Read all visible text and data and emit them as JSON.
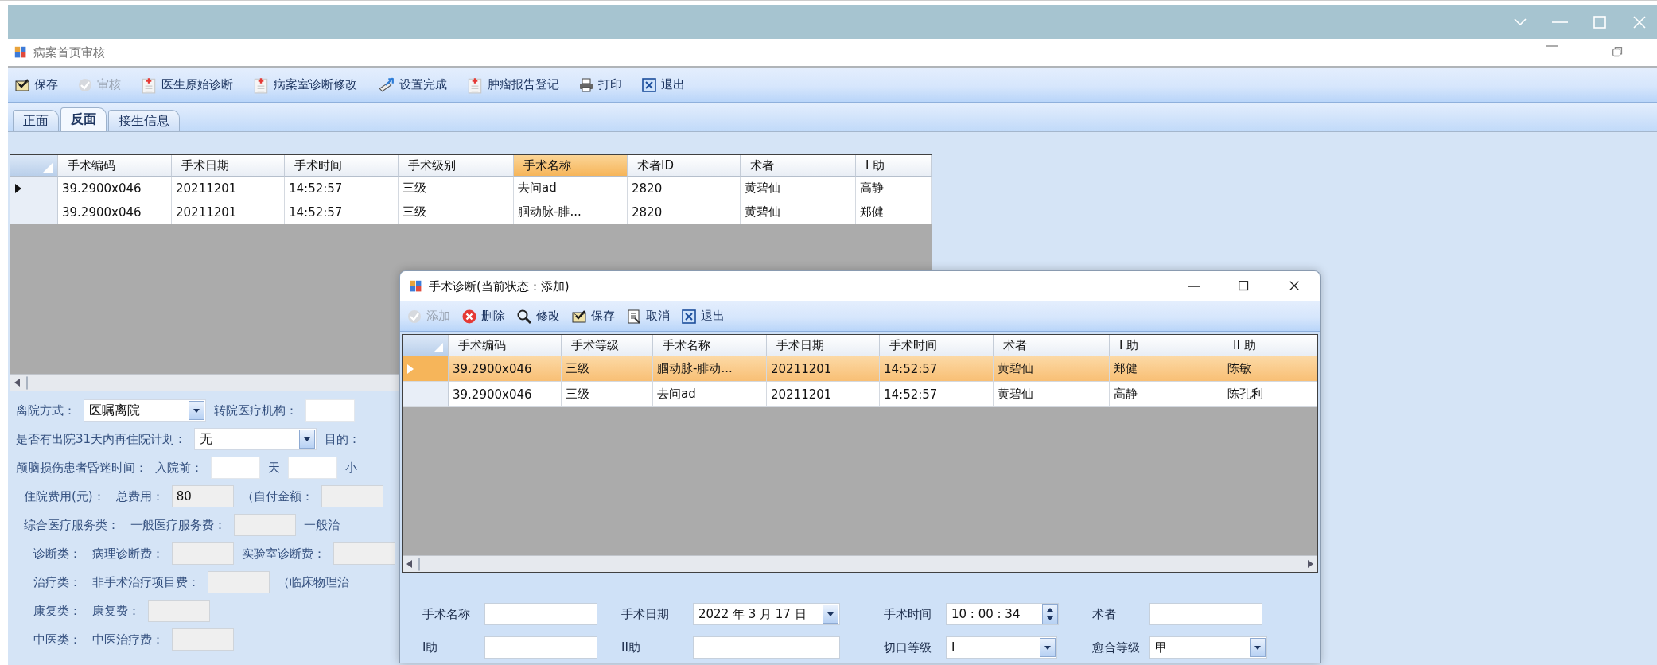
{
  "window": {
    "title": "病案首页审核"
  },
  "toolbar": [
    {
      "label": "保存",
      "kind": "save",
      "disabled": false
    },
    {
      "label": "审核",
      "kind": "check",
      "disabled": true
    },
    {
      "label": "医生原始诊断",
      "kind": "medical-doc",
      "disabled": false
    },
    {
      "label": "病案室诊断修改",
      "kind": "medical-doc",
      "disabled": false
    },
    {
      "label": "设置完成",
      "kind": "wand",
      "disabled": false
    },
    {
      "label": "肿瘤报告登记",
      "kind": "medical-doc",
      "disabled": false
    },
    {
      "label": "打印",
      "kind": "print",
      "disabled": false
    },
    {
      "label": "退出",
      "kind": "exit",
      "disabled": false
    }
  ],
  "tabs": [
    {
      "label": "正面",
      "selected": false
    },
    {
      "label": "反面",
      "selected": true
    },
    {
      "label": "接生信息",
      "selected": false
    }
  ],
  "surgery_table": {
    "columns": [
      {
        "label": "手术编码",
        "highlighted": false
      },
      {
        "label": "手术日期",
        "highlighted": false
      },
      {
        "label": "手术时间",
        "highlighted": false
      },
      {
        "label": "手术级别",
        "highlighted": false
      },
      {
        "label": "手术名称",
        "highlighted": true
      },
      {
        "label": "术者ID",
        "highlighted": false
      },
      {
        "label": "术者",
        "highlighted": false
      },
      {
        "label": "I 助",
        "highlighted": false
      }
    ],
    "rows": [
      {
        "selected": true,
        "cells": [
          "39.2900x046",
          "20211201",
          "14:52:57",
          "三级",
          "去问ad",
          "2820",
          "黄碧仙",
          "高静"
        ]
      },
      {
        "selected": false,
        "cells": [
          "39.2900x046",
          "20211201",
          "14:52:57",
          "三级",
          "腘动脉-腓...",
          "2820",
          "黄碧仙",
          "郑健"
        ]
      }
    ]
  },
  "form": {
    "rows": [
      {
        "kind": "field",
        "items": [
          {
            "kind": "label",
            "text": "离院方式："
          },
          {
            "kind": "combo",
            "value": "医嘱离院"
          },
          {
            "kind": "label",
            "text": "转院医疗机构："
          },
          {
            "kind": "input",
            "disabled": false
          }
        ]
      },
      {
        "kind": "field",
        "items": [
          {
            "kind": "label",
            "text": "是否有出院31天内再住院计划："
          },
          {
            "kind": "combo",
            "value": "无"
          },
          {
            "kind": "label",
            "text": "目的："
          }
        ]
      },
      {
        "kind": "field",
        "items": [
          {
            "kind": "label",
            "text": "颅脑损伤患者昏迷时间："
          },
          {
            "kind": "label",
            "text": "入院前："
          },
          {
            "kind": "input",
            "disabled": false
          },
          {
            "kind": "label",
            "text": "天"
          },
          {
            "kind": "input",
            "disabled": false
          },
          {
            "kind": "label",
            "text": "小"
          }
        ]
      },
      {
        "kind": "fee",
        "items": [
          {
            "kind": "label",
            "text": "住院费用(元)："
          },
          {
            "kind": "label",
            "text": "总费用："
          },
          {
            "kind": "input",
            "value": "80",
            "disabled": true
          },
          {
            "kind": "label",
            "text": "（自付金额："
          },
          {
            "kind": "input",
            "disabled": true
          }
        ]
      },
      {
        "kind": "fee",
        "items": [
          {
            "kind": "label",
            "text": "综合医疗服务类："
          },
          {
            "kind": "label",
            "text": "一般医疗服务费："
          },
          {
            "kind": "input",
            "disabled": true
          },
          {
            "kind": "label",
            "text": "一般治"
          }
        ]
      },
      {
        "kind": "fee",
        "items": [
          {
            "kind": "label",
            "text": "诊断类："
          },
          {
            "kind": "label",
            "text": "病理诊断费："
          },
          {
            "kind": "input",
            "disabled": true
          },
          {
            "kind": "label",
            "text": "实验室诊断费："
          },
          {
            "kind": "input",
            "disabled": true
          }
        ]
      },
      {
        "kind": "fee",
        "items": [
          {
            "kind": "label",
            "text": "治疗类："
          },
          {
            "kind": "label",
            "text": "非手术治疗项目费："
          },
          {
            "kind": "input",
            "disabled": true
          },
          {
            "kind": "label",
            "text": "（临床物理治"
          }
        ]
      },
      {
        "kind": "fee",
        "items": [
          {
            "kind": "label",
            "text": "康复类："
          },
          {
            "kind": "label",
            "text": "康复费："
          },
          {
            "kind": "input",
            "disabled": true
          }
        ]
      },
      {
        "kind": "fee",
        "items": [
          {
            "kind": "label",
            "text": "中医类："
          },
          {
            "kind": "label",
            "text": "中医治疗费："
          },
          {
            "kind": "input",
            "disabled": true
          }
        ]
      }
    ]
  },
  "dialog": {
    "title": "手术诊断(当前状态：添加)",
    "toolbar": [
      {
        "label": "添加",
        "kind": "check",
        "disabled": true
      },
      {
        "label": "删除",
        "kind": "delete",
        "disabled": false
      },
      {
        "label": "修改",
        "kind": "search",
        "disabled": false
      },
      {
        "label": "保存",
        "kind": "save",
        "disabled": false
      },
      {
        "label": "取消",
        "kind": "cancel",
        "disabled": false
      },
      {
        "label": "退出",
        "kind": "exit",
        "disabled": false
      }
    ],
    "table": {
      "columns": [
        {
          "label": "手术编码"
        },
        {
          "label": "手术等级"
        },
        {
          "label": "手术名称"
        },
        {
          "label": "手术日期"
        },
        {
          "label": "手术时间"
        },
        {
          "label": "术者"
        },
        {
          "label": "I 助"
        },
        {
          "label": "II 助"
        }
      ],
      "rows": [
        {
          "selected": true,
          "cells": [
            "39.2900x046",
            "三级",
            "腘动脉-腓动...",
            "20211201",
            "14:52:57",
            "黄碧仙",
            "郑健",
            "陈敏"
          ]
        },
        {
          "selected": false,
          "cells": [
            "39.2900x046",
            "三级",
            "去问ad",
            "20211201",
            "14:52:57",
            "黄碧仙",
            "高静",
            "陈孔利"
          ]
        }
      ]
    },
    "form": {
      "rows": [
        [
          {
            "label": "手术名称",
            "kind": "text"
          },
          {
            "label": "手术日期",
            "kind": "date",
            "value": "2022 年 3 月 17 日"
          },
          {
            "label": "手术时间",
            "kind": "time",
            "value": "10 : 00 : 34"
          },
          {
            "label": "术者",
            "kind": "text"
          }
        ],
        [
          {
            "label": "I助",
            "kind": "text"
          },
          {
            "label": "II助",
            "kind": "text"
          },
          {
            "label": "切口等级",
            "kind": "combo",
            "value": "I"
          },
          {
            "label": "愈合等级",
            "kind": "combo",
            "value": "甲"
          }
        ]
      ]
    }
  }
}
